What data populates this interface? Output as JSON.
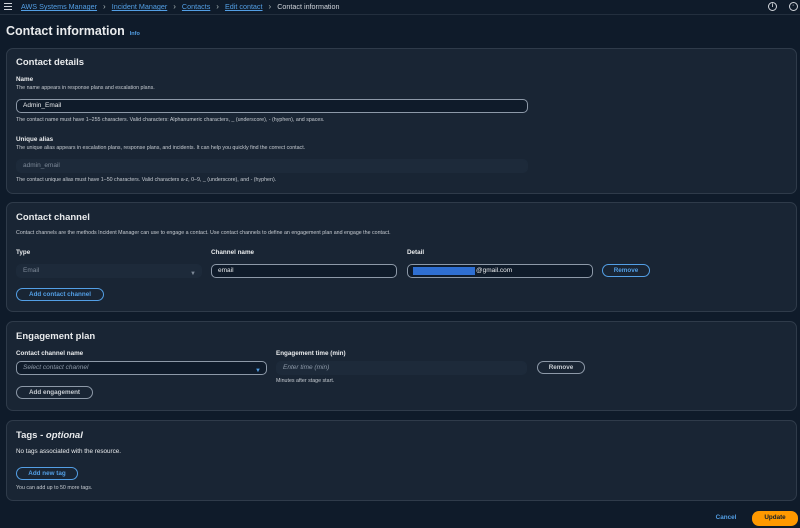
{
  "breadcrumb": {
    "items": [
      "AWS Systems Manager",
      "Incident Manager",
      "Contacts",
      "Edit contact"
    ],
    "current": "Contact information"
  },
  "page": {
    "title": "Contact information",
    "info": "Info"
  },
  "contact_details": {
    "title": "Contact details",
    "name_label": "Name",
    "name_desc": "The name appears in response plans and escalation plans.",
    "name_value": "Admin_Email",
    "name_constraint": "The contact name must have 1–255 characters. Valid characters: Alphanumeric characters, _ (underscore), - (hyphen), and spaces.",
    "alias_label": "Unique alias",
    "alias_desc": "The unique alias appears in escalation plans, response plans, and incidents. It can help you quickly find the correct contact.",
    "alias_value": "admin_email",
    "alias_constraint": "The contact unique alias must have 1–50 characters. Valid characters a-z, 0–9, _ (underscore), and - (hyphen)."
  },
  "contact_channel": {
    "title": "Contact channel",
    "desc": "Contact channels are the methods Incident Manager can use to engage a contact. Use contact channels to define an engagement plan and engage the contact.",
    "type_label": "Type",
    "type_value": "Email",
    "channel_name_label": "Channel name",
    "channel_name_value": "email",
    "detail_label": "Detail",
    "detail_value": "@gmail.com",
    "remove_label": "Remove",
    "add_label": "Add contact channel"
  },
  "engagement_plan": {
    "title": "Engagement plan",
    "channel_label": "Contact channel name",
    "channel_placeholder": "Select contact channel",
    "time_label": "Engagement time (min)",
    "time_placeholder": "Enter time (min)",
    "time_hint": "Minutes after stage start.",
    "remove_label": "Remove",
    "add_label": "Add engagement"
  },
  "tags": {
    "title": "Tags - ",
    "title_optional": "optional",
    "empty": "No tags associated with the resource.",
    "add_label": "Add new tag",
    "hint": "You can add up to 50 more tags."
  },
  "footer": {
    "cancel": "Cancel",
    "update": "Update"
  }
}
